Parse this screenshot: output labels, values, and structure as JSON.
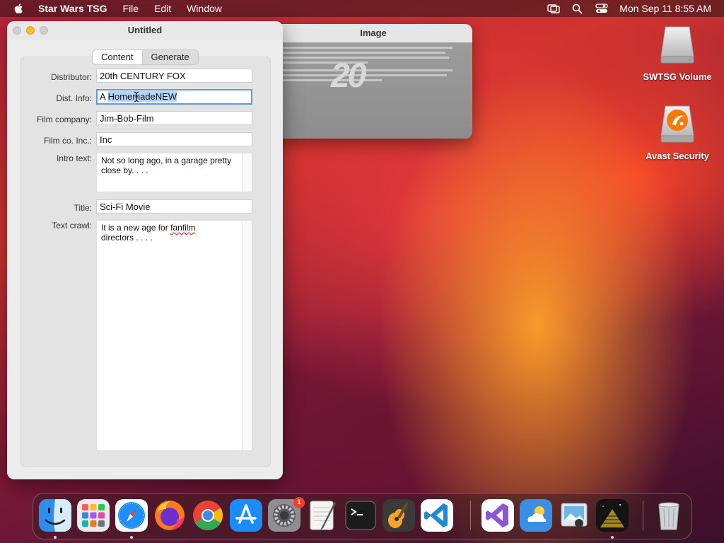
{
  "menubar": {
    "app_name": "Star Wars TSG",
    "menus": [
      "File",
      "Edit",
      "Window"
    ],
    "clock": "Mon Sep 11  8:55 AM"
  },
  "main_window": {
    "title": "Untitled",
    "tabs": [
      {
        "label": "Content",
        "active": true
      },
      {
        "label": "Generate",
        "active": false
      }
    ],
    "fields": {
      "distributor": {
        "label": "Distributor:",
        "value": "20th CENTURY FOX"
      },
      "dist_info": {
        "label": "Dist. Info:",
        "value_prefix": "A ",
        "value_selected": "HomemadeNEW"
      },
      "film_company": {
        "label": "Film company:",
        "value": "Jim-Bob-Film"
      },
      "film_co_inc": {
        "label": "Film co. Inc.:",
        "value": "Inc"
      },
      "intro_text": {
        "label": "Intro text:",
        "line1": "Not so long ago, in a garage pretty",
        "line2": "close by. . . ."
      },
      "title": {
        "label": "Title:",
        "value": "Sci-Fi Movie"
      },
      "text_crawl": {
        "label": "Text crawl:",
        "line1_prefix": "It is a new age for ",
        "line1_misspelled": "fanfilm",
        "line2": "directors . . . ."
      }
    }
  },
  "image_window": {
    "title": "Image",
    "logo_text": "20"
  },
  "desktop_icons": [
    {
      "label": "SWTSG Volume",
      "icon": "drive-icon"
    },
    {
      "label": "Avast Security",
      "icon": "avast-icon"
    }
  ],
  "dock": {
    "settings_badge": "1",
    "items": [
      {
        "name": "finder",
        "color": "#2b8ef0"
      },
      {
        "name": "launchpad",
        "color": "#e9e9ee"
      },
      {
        "name": "safari",
        "color": "#1f8fff"
      },
      {
        "name": "firefox",
        "color": "#ff7a1a"
      },
      {
        "name": "chrome",
        "color": "#ffffff"
      },
      {
        "name": "app-store",
        "color": "#1a8cff"
      },
      {
        "name": "system-settings",
        "color": "#8e8e93"
      },
      {
        "name": "textedit",
        "color": "#f4f4f4"
      },
      {
        "name": "terminal",
        "color": "#1c1c1c"
      },
      {
        "name": "garageband",
        "color": "#3a3a3a"
      },
      {
        "name": "vscode",
        "color": "#ffffff"
      },
      {
        "name": "visual-studio",
        "color": "#ffffff"
      },
      {
        "name": "weather",
        "color": "#3a8ee6"
      },
      {
        "name": "preview",
        "color": "#dfe8f0"
      },
      {
        "name": "star-wars-tsg",
        "color": "#141414"
      },
      {
        "name": "trash",
        "color": "#cfd3d6"
      }
    ]
  }
}
